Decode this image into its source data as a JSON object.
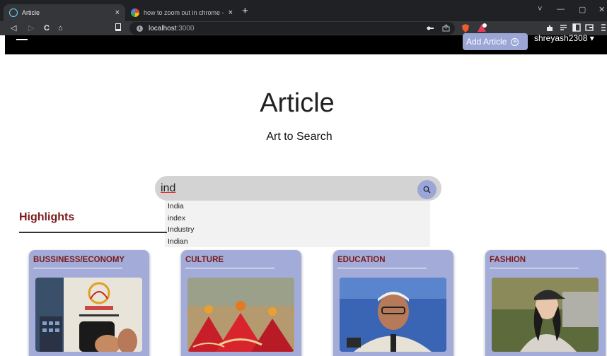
{
  "browser": {
    "tabs": [
      {
        "title": "Article",
        "active": true,
        "close": "×"
      },
      {
        "title": "how to zoom out in chrome - Google",
        "active": false,
        "close": "×"
      }
    ],
    "new_tab": "+",
    "window_controls": [
      "˅",
      "—",
      "▢",
      "✕"
    ],
    "nav": {
      "back": "◁",
      "forward": "▷",
      "reload": "C",
      "home": "⌂"
    },
    "address": {
      "host": "localhost",
      "port": ":3000"
    }
  },
  "app": {
    "add_article_label": "Add Article",
    "add_article_icon": "+",
    "username": "shreyash2308 ▾",
    "title": "Article",
    "subtitle": "Art to Search",
    "search": {
      "value": "ind",
      "placeholder": ""
    },
    "suggestions": [
      "India",
      "index",
      "Industry",
      "Indian"
    ],
    "highlights_label": "Highlights",
    "categories": [
      {
        "label": "BUSSINESS/ECONOMY",
        "image": "aadhaar-fingerprint-photo"
      },
      {
        "label": "CULTURE",
        "image": "folk-dancers-photo"
      },
      {
        "label": "EDUCATION",
        "image": "speaker-portrait-photo"
      },
      {
        "label": "FASHION",
        "image": "woman-cap-street-photo"
      }
    ],
    "colors": {
      "accent": "#9ca6d6",
      "card_bg": "#a3acd8",
      "heading": "#7a1a1a",
      "nav_bg": "#000000"
    }
  }
}
